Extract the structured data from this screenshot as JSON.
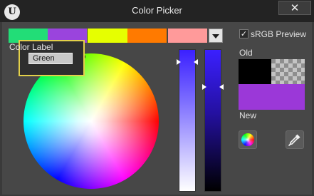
{
  "window": {
    "title": "Color Picker",
    "close_glyph": "✕",
    "logo_glyph": "U"
  },
  "swatches": [
    {
      "name": "swatch-green",
      "color": "#22dd77"
    },
    {
      "name": "swatch-purple",
      "color": "#9a44dd"
    },
    {
      "name": "swatch-yellow",
      "color": "#e6ff00"
    },
    {
      "name": "swatch-orange",
      "color": "#ff7a00"
    },
    {
      "name": "swatch-pink",
      "color": "#ff9a9a"
    }
  ],
  "tooltip": {
    "title": "Color Label",
    "value": "Green",
    "border_color": "#e3d04a"
  },
  "srgb": {
    "label": "sRGB Preview",
    "checked": true,
    "check_glyph": "✓"
  },
  "preview": {
    "old_label": "Old",
    "new_label": "New",
    "old_color": "#000000",
    "new_color": "#9b38d8"
  },
  "icons": {
    "logo": "unreal-logo-icon",
    "close": "close-icon",
    "dropdown": "chevron-down-icon",
    "color_wheel": "color-wheel-icon",
    "eyedropper": "eyedropper-icon"
  }
}
